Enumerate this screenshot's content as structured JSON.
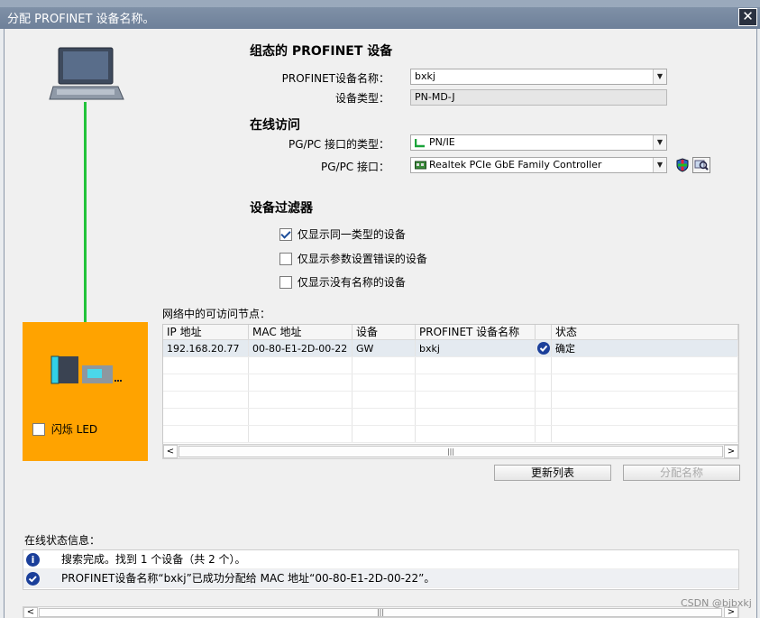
{
  "window": {
    "title": "分配 PROFINET 设备名称。",
    "close_glyph": "✕"
  },
  "configured": {
    "heading": "组态的 PROFINET 设备",
    "name_label": "PROFINET设备名称：",
    "name_value": "bxkj",
    "type_label": "设备类型：",
    "type_value": "PN-MD-J"
  },
  "online": {
    "heading": "在线访问",
    "iface_type_label": "PG/PC 接口的类型：",
    "iface_type_value": "PN/IE",
    "iface_label": "PG/PC 接口：",
    "iface_value": "Realtek PCIe GbE Family Controller"
  },
  "filter": {
    "heading": "设备过滤器",
    "options": [
      {
        "label": "仅显示同一类型的设备",
        "checked": true
      },
      {
        "label": "仅显示参数设置错误的设备",
        "checked": false
      },
      {
        "label": "仅显示没有名称的设备",
        "checked": false
      }
    ]
  },
  "flash_led": {
    "label": "闪烁 LED",
    "checked": false
  },
  "nodes": {
    "caption": "网络中的可访问节点：",
    "columns": [
      "IP 地址",
      "MAC 地址",
      "设备",
      "PROFINET 设备名称",
      "",
      "状态"
    ],
    "rows": [
      {
        "ip": "192.168.20.77",
        "mac": "00-80-E1-2D-00-22",
        "device": "GW",
        "name": "bxkj",
        "status": "确定"
      }
    ]
  },
  "buttons": {
    "refresh": "更新列表",
    "assign": "分配名称"
  },
  "status": {
    "caption": "在线状态信息：",
    "messages": [
      {
        "icon": "info",
        "text": "搜索完成。找到 1 个设备（共 2 个）。"
      },
      {
        "icon": "check",
        "text": "PROFINET设备名称“bxkj”已成功分配给 MAC 地址“00-80-E1-2D-00-22”。"
      }
    ]
  },
  "watermark": "CSDN @bjbxkj",
  "colors": {
    "orange": "#ffa300",
    "link_green": "#22c33a",
    "accent_blue": "#1b3f9a"
  }
}
